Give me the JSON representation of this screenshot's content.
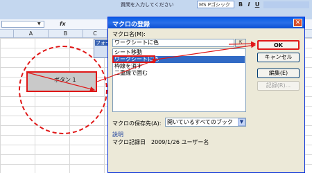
{
  "excel": {
    "font_name": "MS Pゴシック",
    "menu_hint": "質問を入力してください",
    "columns": [
      "A",
      "B",
      "C"
    ],
    "fx_label": "fx",
    "shape_label": "ボタン 1",
    "forms_toolbar_title": "フォー",
    "toolbar_buttons": [
      "B",
      "I",
      "U"
    ]
  },
  "dialog": {
    "title": "マクロの登録",
    "close_glyph": "✕",
    "macro_name_label": "マクロ名(M):",
    "macro_name_value": "ワークシートに色",
    "ref_button_glyph": "⇱",
    "list_items": [
      {
        "label": "シート移動",
        "selected": false
      },
      {
        "label": "ワークシートに色",
        "selected": true
      },
      {
        "label": "枠線を消す",
        "selected": false
      },
      {
        "label": "二重線で囲む",
        "selected": false
      }
    ],
    "buttons": {
      "ok": "OK",
      "cancel": "キャンセル",
      "edit": "編集(E)",
      "record": "記録(R)..."
    },
    "store_label": "マクロの保存先(A):",
    "store_value": "開いているすべてのブック",
    "dropdown_glyph": "▼",
    "description_label": "説明",
    "description_text": "マクロ記録日　2009/1/26  ユーザー名"
  },
  "colors": {
    "annotation_red": "#e01818",
    "title_blue": "#0a5ee6",
    "selection_blue": "#316ac5"
  }
}
